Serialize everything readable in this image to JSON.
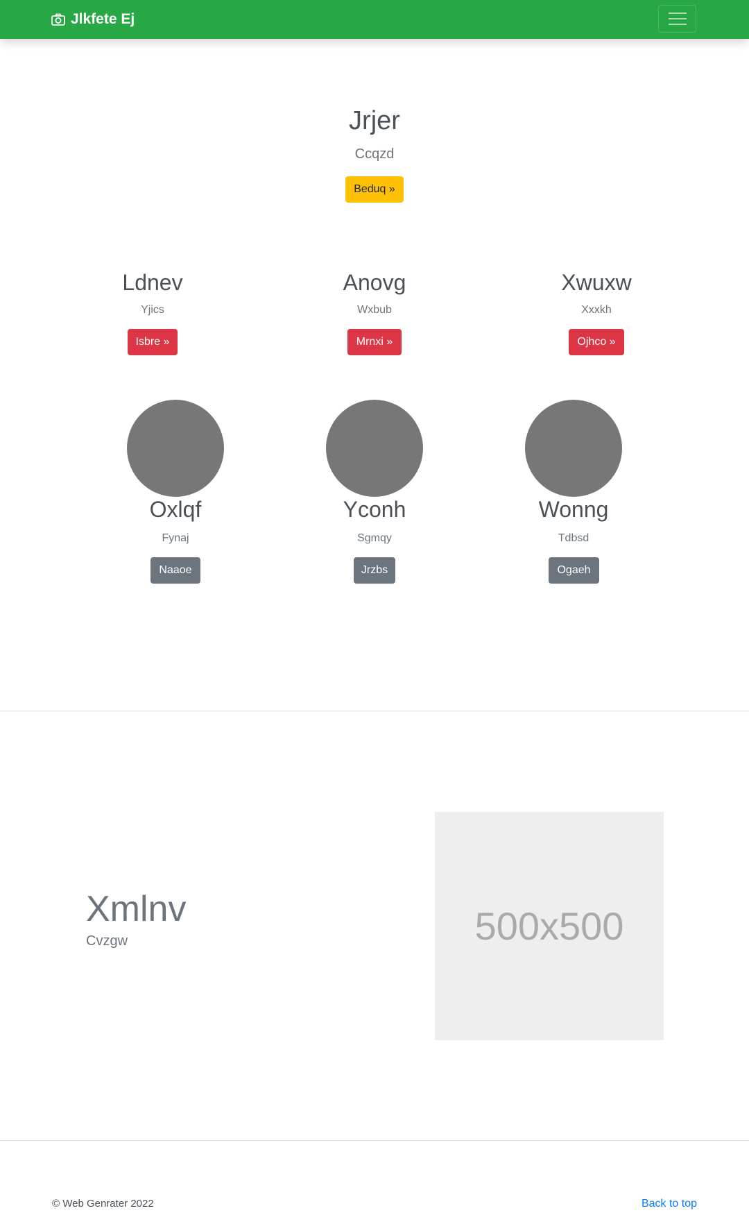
{
  "navbar": {
    "brand": "Jlkfete Ej",
    "brand_icon": "camera-icon",
    "toggler_icon": "hamburger-menu-icon",
    "color": "#28a745"
  },
  "hero": {
    "title": "Jrjer",
    "subtitle": "Ccqzd",
    "button": "Beduq »"
  },
  "columns": [
    {
      "title": "Ldnev",
      "text": "Yjics",
      "button": "Isbre »"
    },
    {
      "title": "Anovg",
      "text": "Wxbub",
      "button": "Mrnxi »"
    },
    {
      "title": "Xwuxw",
      "text": "Xxxkh",
      "button": "Ojhco »"
    }
  ],
  "team": [
    {
      "name": "Oxlqf",
      "role": "Fynaj",
      "button": "Naaoe"
    },
    {
      "name": "Yconh",
      "role": "Sgmqy",
      "button": "Jrzbs"
    },
    {
      "name": "Wonng",
      "role": "Tdbsd",
      "button": "Ogaeh"
    }
  ],
  "feature": {
    "heading": "Xmlnv",
    "subheading": "Cvzgw",
    "image_label": "500x500"
  },
  "footer": {
    "copyright": "© Web Genrater 2022",
    "back_to_top": "Back to top"
  },
  "colors": {
    "warning": "#ffc107",
    "danger": "#dc3545",
    "secondary": "#6c757d",
    "link": "#007bff"
  }
}
